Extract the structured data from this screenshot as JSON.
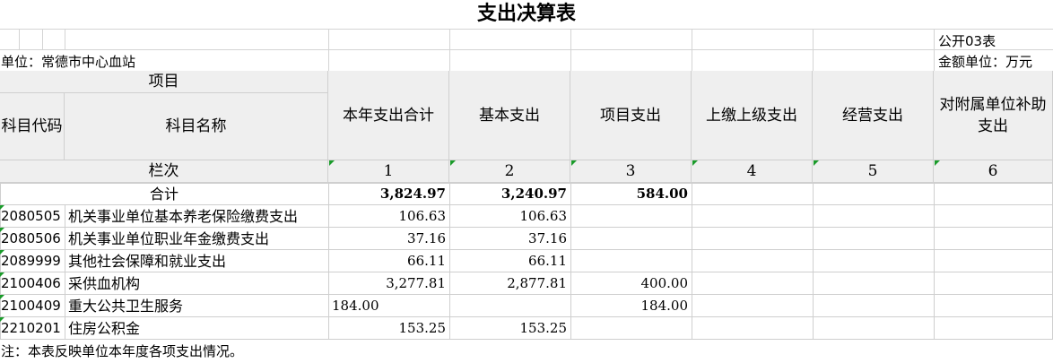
{
  "title": "支出决算表",
  "form_code": "公开03表",
  "unit_label": "单位：常德市中心血站",
  "amount_unit": "金额单位：万元",
  "headers": {
    "project": "项目",
    "code": "科目代码",
    "name": "科目名称",
    "total": "本年支出合计",
    "basic": "基本支出",
    "project_exp": "项目支出",
    "upper": "上缴上级支出",
    "business": "经营支出",
    "subsidy": "对附属单位补助支出"
  },
  "column_index": {
    "label": "栏次",
    "numbers": [
      "1",
      "2",
      "3",
      "4",
      "5",
      "6"
    ]
  },
  "total_row": {
    "label": "合计",
    "total": "3,824.97",
    "basic": "3,240.97",
    "project_exp": "584.00"
  },
  "rows": [
    {
      "code": "2080505",
      "name": "机关事业单位基本养老保险缴费支出",
      "total": "106.63",
      "basic": "106.63",
      "project_exp": ""
    },
    {
      "code": "2080506",
      "name": "机关事业单位职业年金缴费支出",
      "total": "37.16",
      "basic": "37.16",
      "project_exp": ""
    },
    {
      "code": "2089999",
      "name": "其他社会保障和就业支出",
      "total": "66.11",
      "basic": "66.11",
      "project_exp": ""
    },
    {
      "code": "2100406",
      "name": "采供血机构",
      "total": "3,277.81",
      "basic": "2,877.81",
      "project_exp": "400.00"
    },
    {
      "code": "2100409",
      "name": "重大公共卫生服务",
      "total": "184.00",
      "basic": "",
      "project_exp": "184.00"
    },
    {
      "code": "2210201",
      "name": "住房公积金",
      "total": "153.25",
      "basic": "153.25",
      "project_exp": ""
    }
  ],
  "note": "注：本表反映单位本年度各项支出情况。"
}
